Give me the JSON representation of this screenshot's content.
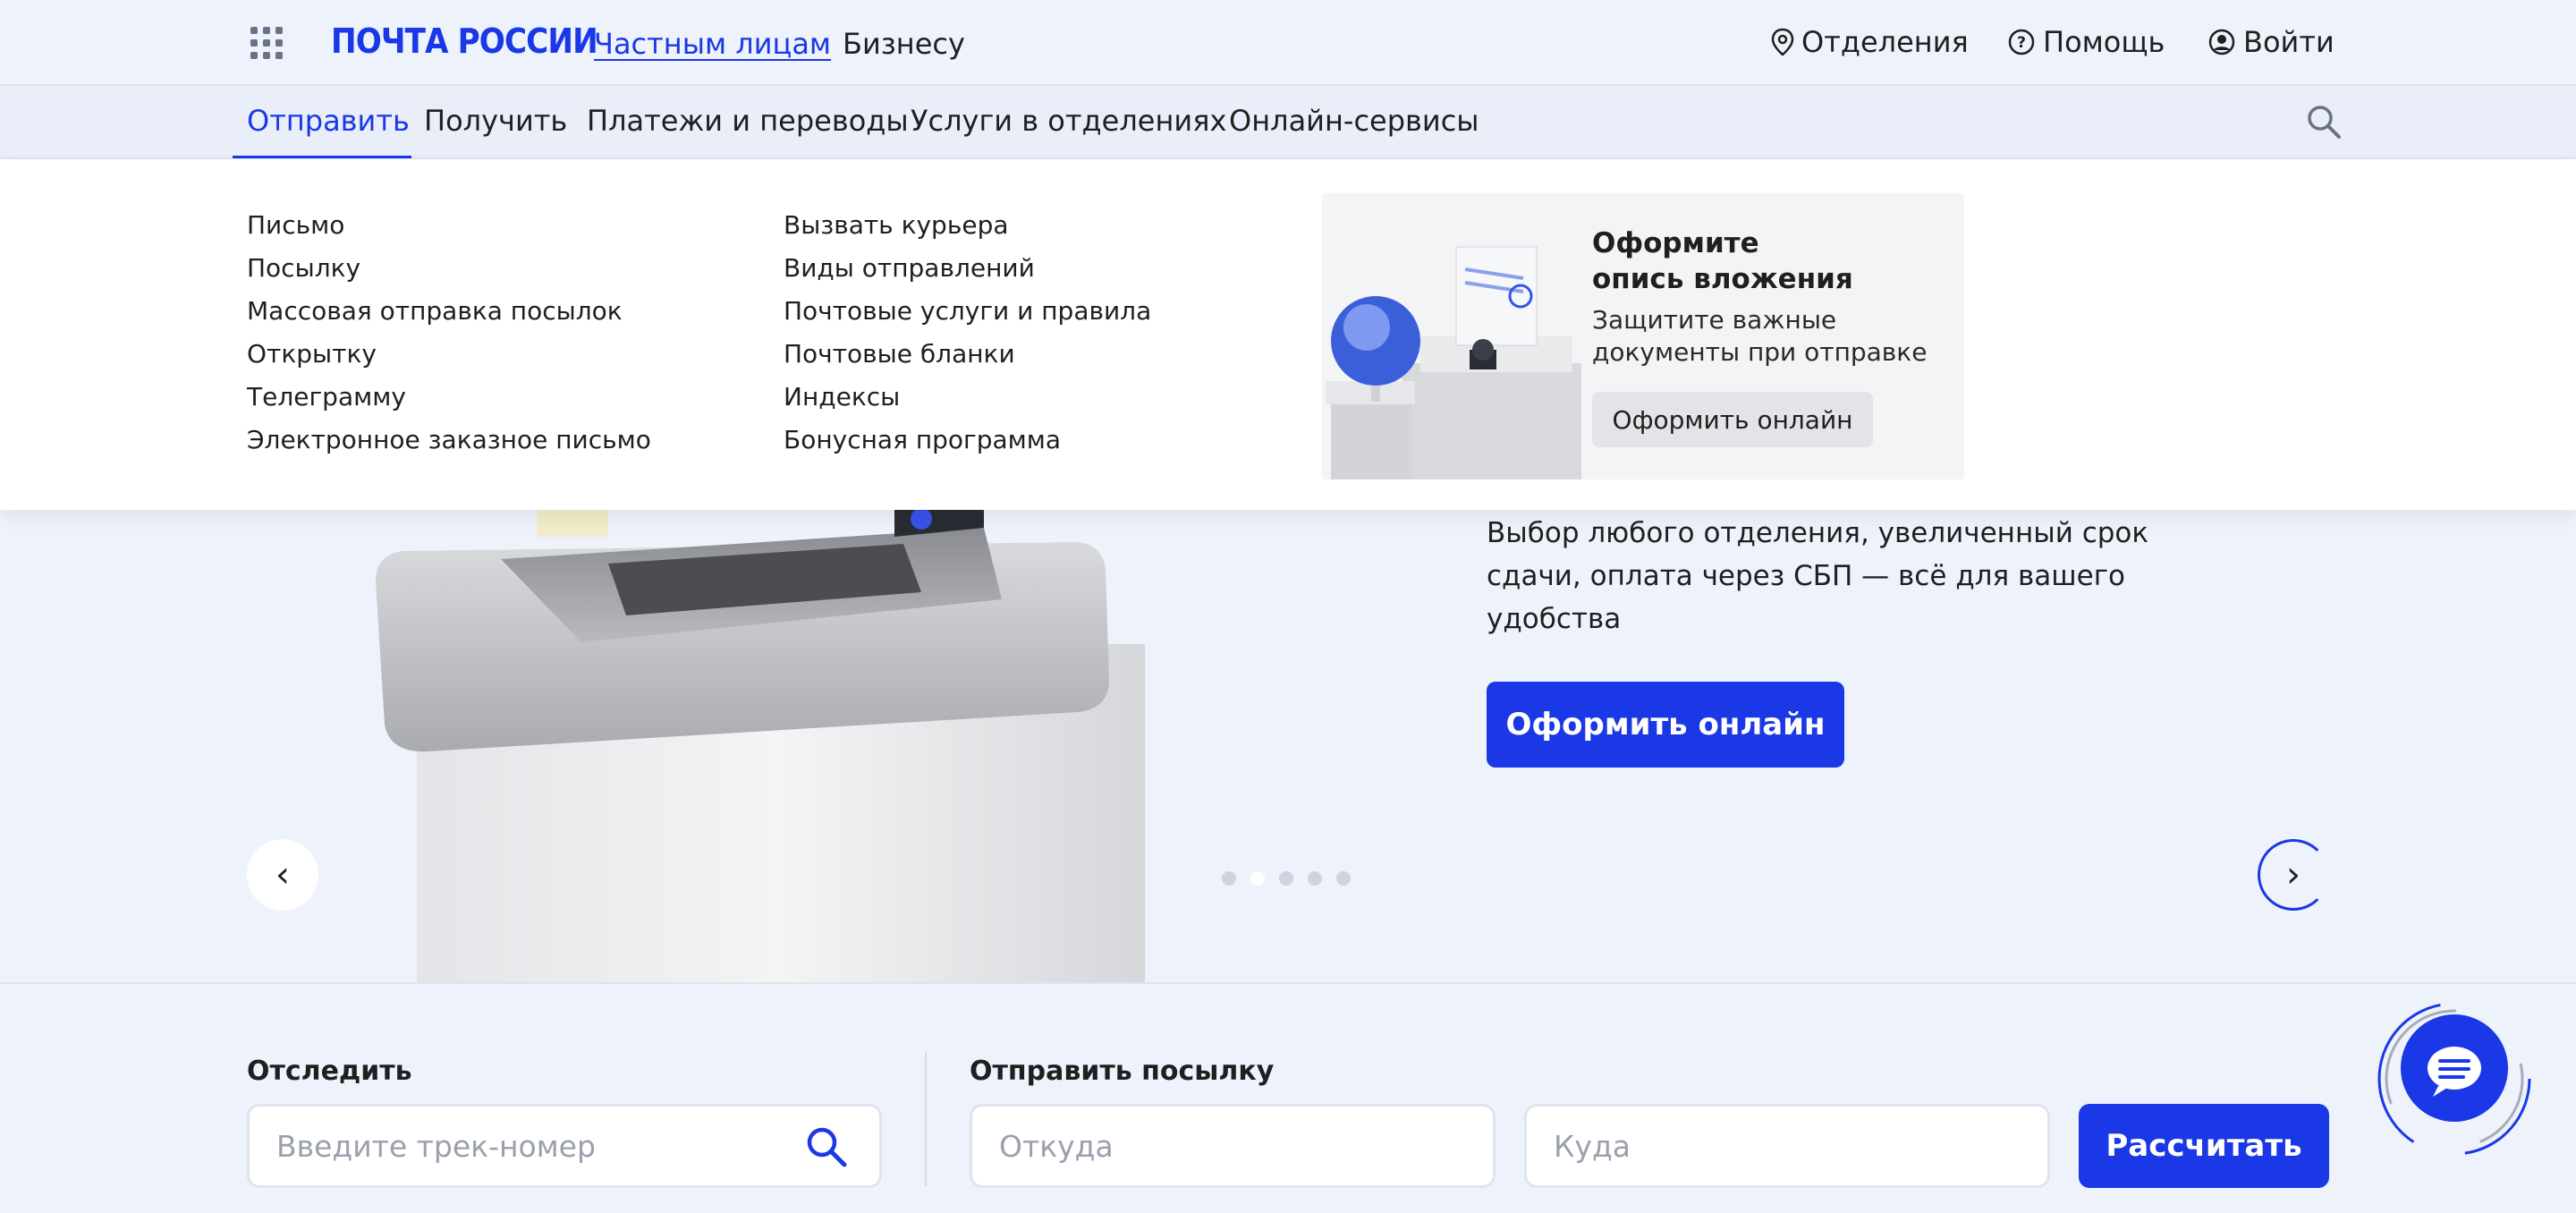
{
  "header": {
    "logo": "ПОЧТА РОССИИ",
    "audience_tabs": [
      {
        "label": "Частным лицам",
        "active": true
      },
      {
        "label": "Бизнесу",
        "active": false
      }
    ],
    "right_links": [
      {
        "label": "Отделения",
        "icon": "location-pin-icon"
      },
      {
        "label": "Помощь",
        "icon": "help-circle-icon"
      },
      {
        "label": "Войти",
        "icon": "user-circle-icon"
      }
    ]
  },
  "nav": {
    "items": [
      {
        "label": "Отправить",
        "active": true
      },
      {
        "label": "Получить"
      },
      {
        "label": "Платежи и переводы"
      },
      {
        "label": "Услуги в отделениях"
      },
      {
        "label": "Онлайн-сервисы"
      }
    ]
  },
  "dropdown": {
    "col1": [
      "Письмо",
      "Посылку",
      "Массовая отправка посылок",
      "Открытку",
      "Телеграмму",
      "Электронное заказное письмо"
    ],
    "col2": [
      "Вызвать курьера",
      "Виды отправлений",
      "Почтовые услуги и правила",
      "Почтовые бланки",
      "Индексы",
      "Бонусная программа"
    ],
    "promo": {
      "title_line1": "Оформите",
      "title_line2": "опись вложения",
      "text_line1": "Защитите важные",
      "text_line2": "документы при отправке",
      "button": "Оформить онлайн"
    }
  },
  "hero": {
    "text_line1": "Выбор любого отделения, увеличенный срок",
    "text_line2": "сдачи, оплата через СБП — всё для вашего",
    "text_line3": "удобства",
    "button": "Оформить онлайн",
    "prev": "‹",
    "next": "›",
    "dots_count": 5,
    "active_dot": 2
  },
  "tracking": {
    "label": "Отследить",
    "placeholder": "Введите трек-номер"
  },
  "send_parcel": {
    "label": "Отправить посылку",
    "from_placeholder": "Откуда",
    "to_placeholder": "Куда",
    "button": "Рассчитать"
  },
  "colors": {
    "brand_blue": "#1a38e6",
    "page_bg": "#eef2fb"
  }
}
